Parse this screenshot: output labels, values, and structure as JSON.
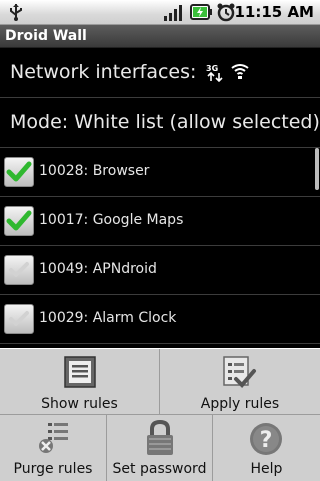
{
  "status_bar": {
    "time": "11:15 AM",
    "icons": [
      "usb-icon",
      "signal-icon",
      "battery-charging-icon",
      "alarm-clock-icon"
    ]
  },
  "title_bar": {
    "title": "Droid Wall"
  },
  "network": {
    "label": "Network interfaces:",
    "icons": [
      "3g-data-icon",
      "wifi-icon"
    ]
  },
  "mode": {
    "label": "Mode: White list (allow selected)"
  },
  "apps": [
    {
      "label": "10028: Browser",
      "checked": true
    },
    {
      "label": "10017: Google Maps",
      "checked": true
    },
    {
      "label": "10049: APNdroid",
      "checked": false
    },
    {
      "label": "10029: Alarm Clock",
      "checked": false
    }
  ],
  "menu": {
    "show_rules": "Show rules",
    "apply_rules": "Apply rules",
    "purge_rules": "Purge rules",
    "set_password": "Set password",
    "help": "Help"
  },
  "colors": {
    "checked": "#2fb82f",
    "unchecked": "#cfcfcf",
    "menu_bg": "#e1e1e1"
  }
}
